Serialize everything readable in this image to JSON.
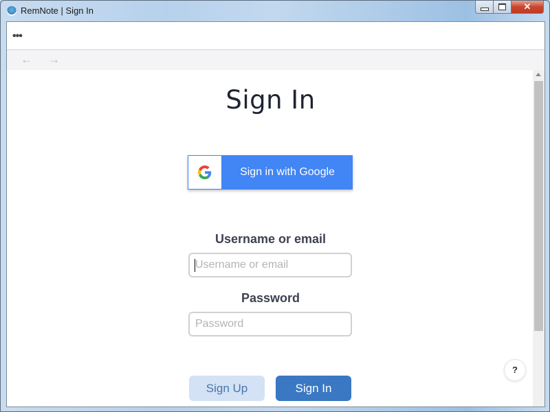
{
  "window": {
    "title": "RemNote | Sign In",
    "controls": {
      "minimize": "minimize",
      "maximize": "maximize",
      "close": "✕"
    }
  },
  "menubar": {
    "menu_label": "•••"
  },
  "nav": {
    "back": "←",
    "forward": "→"
  },
  "page": {
    "title": "Sign In",
    "google_button": "Sign in with Google",
    "username": {
      "label": "Username or email",
      "placeholder": "Username or email",
      "value": ""
    },
    "password": {
      "label": "Password",
      "placeholder": "Password",
      "value": ""
    },
    "signup_button": "Sign Up",
    "signin_button": "Sign In",
    "help_button": "?"
  },
  "colors": {
    "google_blue": "#4285f4",
    "primary": "#3a78c3",
    "secondary_bg": "#d3e2f4",
    "secondary_text": "#4a74ad",
    "title_text": "#1f2433"
  }
}
